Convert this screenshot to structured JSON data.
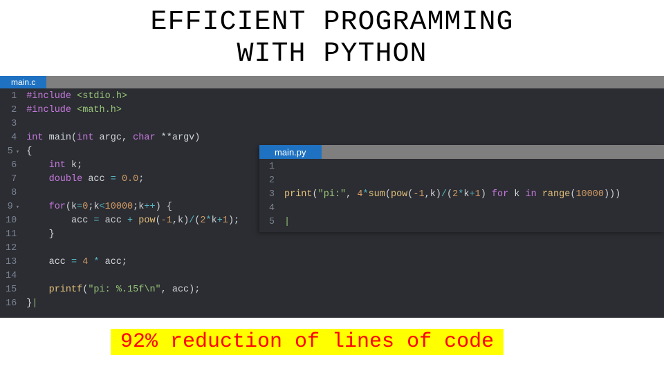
{
  "title_line1": "EFFICIENT PROGRAMMING",
  "title_line2": "WITH PYTHON",
  "highlight": "92% reduction of lines of code",
  "c_panel": {
    "tab": "main.c",
    "line_numbers": [
      "1",
      "2",
      "3",
      "4",
      "5",
      "6",
      "7",
      "8",
      "9",
      "10",
      "11",
      "12",
      "13",
      "14",
      "15",
      "16"
    ],
    "code": {
      "l1_pre": "#include ",
      "l1_inc": "<stdio.h>",
      "l2_pre": "#include ",
      "l2_inc": "<math.h>",
      "l4_a": "int",
      "l4_b": " main(",
      "l4_c": "int",
      "l4_d": " argc, ",
      "l4_e": "char",
      "l4_f": " **argv)",
      "l5": "{",
      "l6_a": "    int",
      "l6_b": " k;",
      "l7_a": "    double",
      "l7_b": " acc ",
      "l7_c": "=",
      "l7_d": " 0.0",
      "l7_e": ";",
      "l9_a": "    for",
      "l9_b": "(k",
      "l9_c": "=",
      "l9_d": "0",
      "l9_e": ";k",
      "l9_f": "<",
      "l9_g": "10000",
      "l9_h": ";k",
      "l9_i": "++",
      "l9_j": ") {",
      "l10_a": "        acc ",
      "l10_b": "=",
      "l10_c": " acc ",
      "l10_d": "+",
      "l10_e": " pow",
      "l10_f": "(",
      "l10_g": "-1",
      "l10_h": ",k)",
      "l10_i": "/",
      "l10_j": "(",
      "l10_k": "2",
      "l10_l": "*",
      "l10_m": "k",
      "l10_n": "+",
      "l10_o": "1",
      "l10_p": ");",
      "l11": "    }",
      "l13_a": "    acc ",
      "l13_b": "=",
      "l13_c": " 4",
      "l13_d": " *",
      "l13_e": " acc;",
      "l15_a": "    printf",
      "l15_b": "(",
      "l15_c": "\"pi: %.15f\\n\"",
      "l15_d": ", acc);",
      "l16": "}"
    }
  },
  "py_panel": {
    "tab": "main.py",
    "line_numbers": [
      "1",
      "2",
      "3",
      "4",
      "5"
    ],
    "code": {
      "l3_a": "print",
      "l3_b": "(",
      "l3_c": "\"pi:\"",
      "l3_d": ", ",
      "l3_e": "4",
      "l3_f": "*",
      "l3_g": "sum",
      "l3_h": "(",
      "l3_i": "pow",
      "l3_j": "(",
      "l3_k": "-1",
      "l3_l": ",k)",
      "l3_m": "/",
      "l3_n": "(",
      "l3_o": "2",
      "l3_p": "*",
      "l3_q": "k",
      "l3_r": "+",
      "l3_s": "1",
      "l3_t": ") ",
      "l3_u": "for",
      "l3_v": " k ",
      "l3_w": "in",
      "l3_x": " range",
      "l3_y": "(",
      "l3_z": "10000",
      "l3_za": ")))"
    }
  }
}
